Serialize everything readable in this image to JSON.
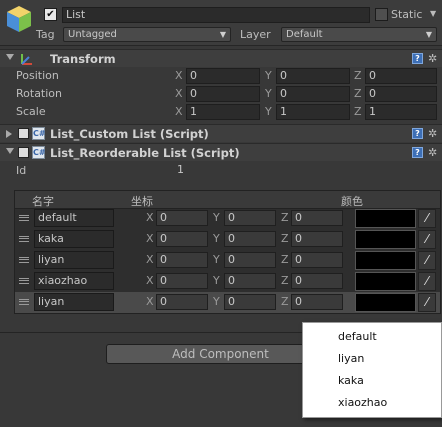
{
  "game_object": {
    "name": "List",
    "static_label": "Static",
    "tag_label": "Tag",
    "tag_value": "Untagged",
    "layer_label": "Layer",
    "layer_value": "Default",
    "active": true,
    "static": false
  },
  "transform": {
    "title": "Transform",
    "rows": [
      {
        "label": "Position",
        "x": "0",
        "y": "0",
        "z": "0"
      },
      {
        "label": "Rotation",
        "x": "0",
        "y": "0",
        "z": "0"
      },
      {
        "label": "Scale",
        "x": "1",
        "y": "1",
        "z": "1"
      }
    ],
    "axes": {
      "x": "X",
      "y": "Y",
      "z": "Z"
    }
  },
  "custom_list": {
    "title": "List_Custom List (Script)"
  },
  "reorderable_list": {
    "title": "List_Reorderable List (Script)",
    "id_label": "Id",
    "id_value": "1",
    "columns": {
      "name": "名字",
      "coord": "坐标",
      "color": "颜色"
    },
    "items": [
      {
        "name": "default",
        "x": "0",
        "y": "0",
        "z": "0",
        "color": "#000000"
      },
      {
        "name": "kaka",
        "x": "0",
        "y": "0",
        "z": "0",
        "color": "#000000"
      },
      {
        "name": "liyan",
        "x": "0",
        "y": "0",
        "z": "0",
        "color": "#000000"
      },
      {
        "name": "xiaozhao",
        "x": "0",
        "y": "0",
        "z": "0",
        "color": "#000000"
      },
      {
        "name": "liyan",
        "x": "0",
        "y": "0",
        "z": "0",
        "color": "#000000"
      }
    ]
  },
  "add_component_label": "Add Component",
  "popup_menu": {
    "items": [
      "default",
      "liyan",
      "kaka",
      "xiaozhao"
    ]
  },
  "icons": {
    "cube": "cube-icon",
    "help": "help-icon",
    "gear": "gear-icon",
    "script": "script-icon",
    "picker": "eyedropper-icon",
    "transform": "transform-icon"
  }
}
